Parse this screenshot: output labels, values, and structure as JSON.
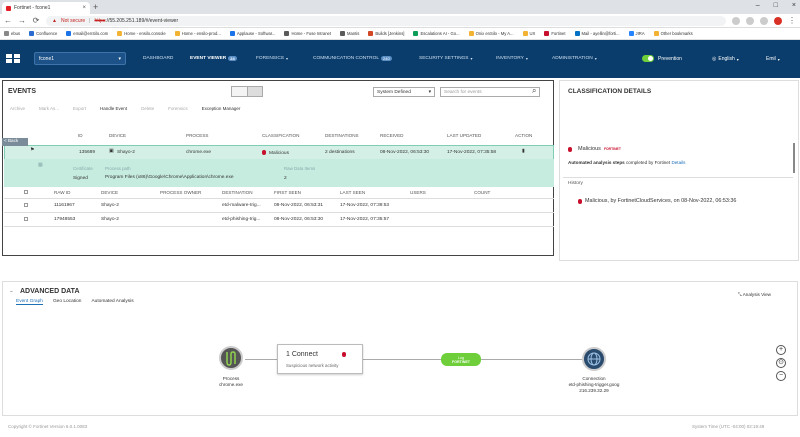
{
  "browser": {
    "tab_title": "Fortinet - fcone1",
    "url_warning": "Not secure",
    "url_https": "https",
    "url_rest": "://55.205.251.189/#/event-viewer",
    "bookmarks": [
      "ebus",
      "Confluence",
      "email@enSilo.com",
      "Home - ensilo.console",
      "Home - ensilo-prod...",
      "Applause - Softwar...",
      "Home - Fuse Intranet",
      "Mantis",
      "Builds [Jenkins]",
      "Escalations AI - Go...",
      "Onix enSilo - My A...",
      "UX",
      "Fortinet",
      "Mail - ayellin@forti...",
      "JIRA",
      "Other bookmarks"
    ]
  },
  "header": {
    "tenant": "fcone1",
    "nav": [
      {
        "label": "DASHBOARD",
        "badge": ""
      },
      {
        "label": "EVENT VIEWER",
        "badge": "24"
      },
      {
        "label": "FORENSICS",
        "badge": ""
      },
      {
        "label": "COMMUNICATION CONTROL",
        "badge": "240"
      },
      {
        "label": "SECURITY SETTINGS",
        "badge": ""
      },
      {
        "label": "INVENTORY",
        "badge": ""
      },
      {
        "label": "ADMINISTRATION",
        "badge": ""
      }
    ],
    "mode": "Prevention",
    "language": "English",
    "user": "Emil"
  },
  "events": {
    "title": "EVENTS",
    "filter": "System Defined",
    "search_placeholder": "Search for events",
    "toolbar": [
      "Archive",
      "Mark As...",
      "Export",
      "Handle Event",
      "Delete",
      "Forensics",
      "Exception Manager"
    ],
    "back_label": "< Back",
    "columns": [
      "ID",
      "DEVICE",
      "PROCESS",
      "CLASSIFICATION",
      "DESTINATIONS",
      "RECEIVED",
      "LAST UPDATED",
      "ACTION"
    ],
    "row": {
      "id": "135689",
      "device": "Shayo-2",
      "process": "chrome.exe",
      "classification": "Malicious",
      "destinations": "2 destinations",
      "received": "08-Nov-2022, 06:53:30",
      "last_updated": "17-Nov-2022, 07:35:58"
    },
    "detail": {
      "cert_label": "Certificate",
      "cert_value": "Signed",
      "path_label": "Process path",
      "path_value": "Program Files (x86)\\Google\\Chrome\\Application\\chrome.exe",
      "raw_label": "Raw Data Items",
      "raw_value": "2"
    },
    "sub_columns": [
      "RAW ID",
      "DEVICE",
      "PROCESS OWNER",
      "DESTINATION",
      "FIRST SEEN",
      "LAST SEEN",
      "USERS",
      "COUNT"
    ],
    "sub_rows": [
      {
        "raw_id": "11161967",
        "device": "Shayo-2",
        "destination": "etd-malware-trig...",
        "first_seen": "08-Nov-2022, 06:53:31",
        "last_seen": "17-Nov-2022, 07:39:53"
      },
      {
        "raw_id": "17948553",
        "device": "Shayo-2",
        "destination": "etd-phishing-trig...",
        "first_seen": "08-Nov-2022, 06:53:30",
        "last_seen": "17-Nov-2022, 07:35:57"
      }
    ]
  },
  "classification": {
    "title": "CLASSIFICATION DETAILS",
    "verdict": "Malicious",
    "brand": "FORTINET",
    "aas_bold": "Automated analysis steps",
    "aas_rest": "completed by Fortinet",
    "aas_link": "Details",
    "history_label": "History",
    "history_item": "Malicious, by FortinetCloudServices, on 08-Nov-2022, 06:53:36"
  },
  "advanced": {
    "title": "ADVANCED DATA",
    "tabs": [
      "Event Graph",
      "Geo Location",
      "Automated Analysis"
    ],
    "analysis_view": "Analysis View",
    "process_label": "Process",
    "process_name": "chrome.exe",
    "connect_title": "1 Connect",
    "connect_sub": "Suspicious network activity",
    "log_label": "Log",
    "log_brand": "FORTINET",
    "conn_label": "Connection",
    "conn_host": "etd-phishing-trigger.goog",
    "conn_ip": "216.239.32.29"
  },
  "footer": {
    "copyright": "Copyright © Fortinet Version 6.0.1.0083",
    "system_time": "System Time (UTC -04:00) 02:19:49"
  }
}
